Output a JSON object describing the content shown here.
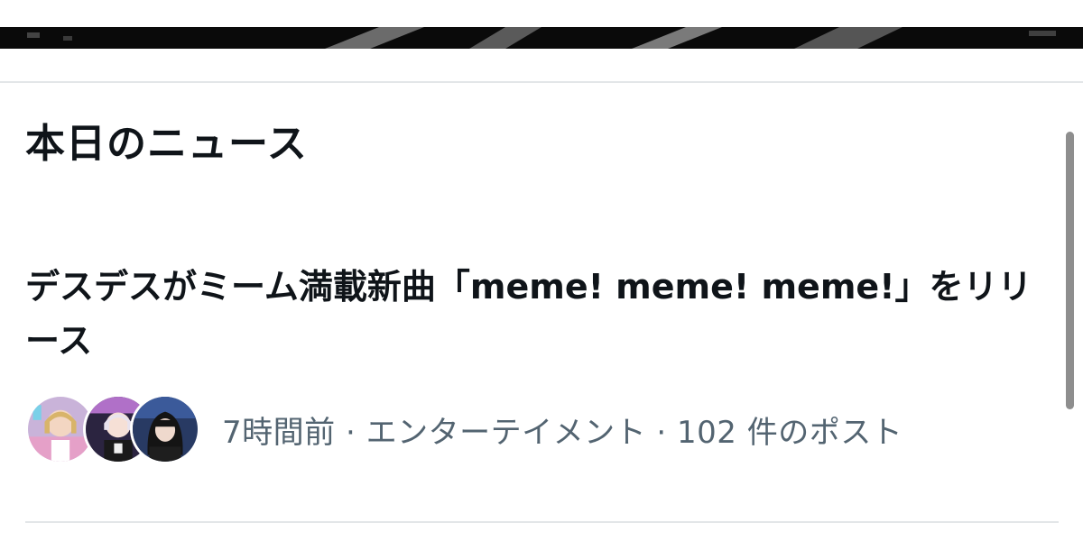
{
  "section": {
    "title": "本日のニュース"
  },
  "news": {
    "headline": "デスデスがミーム満載新曲「meme! meme! meme!」をリリース",
    "meta": {
      "time": "7時間前",
      "separator": " · ",
      "category": "エンターテイメント",
      "posts": "102 件のポスト"
    },
    "avatars": [
      "avatar-member-1",
      "avatar-member-2",
      "avatar-member-3"
    ]
  },
  "colors": {
    "text_primary": "#0f1419",
    "text_secondary": "#536471",
    "divider": "#e3e6e8",
    "scrollbar": "#8e8e8e"
  }
}
